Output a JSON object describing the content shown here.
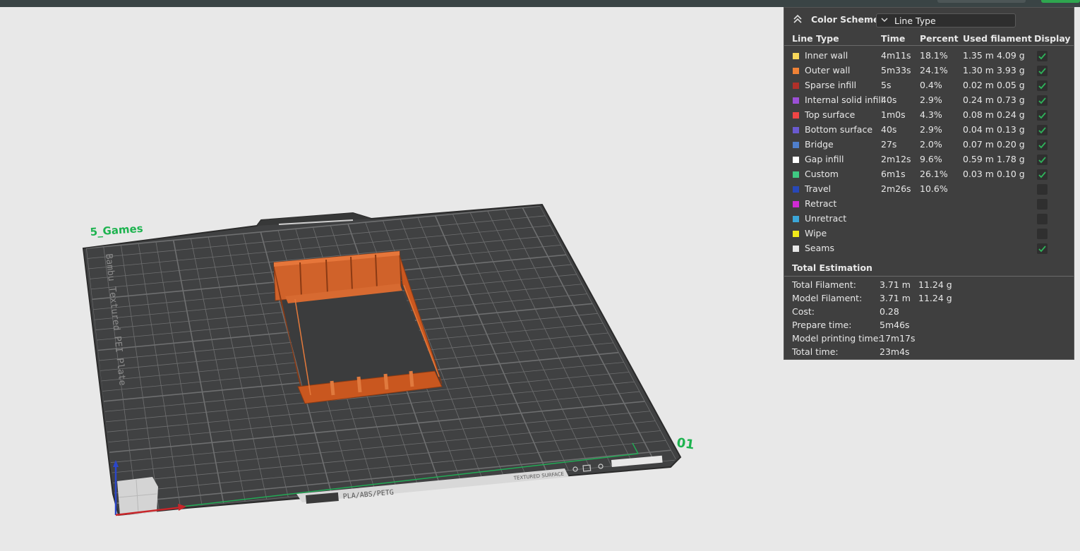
{
  "plate": {
    "name": "5_Games",
    "number": "01",
    "bed_label": "Bambu Textured PEI Plate",
    "material_label": "PLA/ABS/PETG",
    "surface_label": "TEXTURED SURFACE"
  },
  "panel": {
    "scheme_title": "Color Scheme",
    "scheme_value": "Line Type",
    "headers": {
      "line_type": "Line Type",
      "time": "Time",
      "percent": "Percent",
      "used": "Used filament",
      "display": "Display"
    },
    "rows": [
      {
        "name": "Inner wall",
        "color": "#f7d75a",
        "time": "4m11s",
        "percent": "18.1%",
        "meters": "1.35 m",
        "grams": "4.09 g",
        "checked": true
      },
      {
        "name": "Outer wall",
        "color": "#f08236",
        "time": "5m33s",
        "percent": "24.1%",
        "meters": "1.30 m",
        "grams": "3.93 g",
        "checked": true
      },
      {
        "name": "Sparse infill",
        "color": "#b03029",
        "time": "5s",
        "percent": "0.4%",
        "meters": "0.02 m",
        "grams": "0.05 g",
        "checked": true
      },
      {
        "name": "Internal solid infill",
        "color": "#9b4fd6",
        "time": "40s",
        "percent": "2.9%",
        "meters": "0.24 m",
        "grams": "0.73 g",
        "checked": true
      },
      {
        "name": "Top surface",
        "color": "#f04545",
        "time": "1m0s",
        "percent": "4.3%",
        "meters": "0.08 m",
        "grams": "0.24 g",
        "checked": true
      },
      {
        "name": "Bottom surface",
        "color": "#6a5ad0",
        "time": "40s",
        "percent": "2.9%",
        "meters": "0.04 m",
        "grams": "0.13 g",
        "checked": true
      },
      {
        "name": "Bridge",
        "color": "#4f7fcc",
        "time": "27s",
        "percent": "2.0%",
        "meters": "0.07 m",
        "grams": "0.20 g",
        "checked": true
      },
      {
        "name": "Gap infill",
        "color": "#ffffff",
        "time": "2m12s",
        "percent": "9.6%",
        "meters": "0.59 m",
        "grams": "1.78 g",
        "checked": true
      },
      {
        "name": "Custom",
        "color": "#3fc983",
        "time": "6m1s",
        "percent": "26.1%",
        "meters": "0.03 m",
        "grams": "0.10 g",
        "checked": true
      },
      {
        "name": "Travel",
        "color": "#2848b8",
        "time": "2m26s",
        "percent": "10.6%",
        "meters": "",
        "grams": "",
        "checked": false
      },
      {
        "name": "Retract",
        "color": "#d02ad4",
        "time": "",
        "percent": "",
        "meters": "",
        "grams": "",
        "checked": false
      },
      {
        "name": "Unretract",
        "color": "#3ba6d8",
        "time": "",
        "percent": "",
        "meters": "",
        "grams": "",
        "checked": false
      },
      {
        "name": "Wipe",
        "color": "#f2ea1a",
        "time": "",
        "percent": "",
        "meters": "",
        "grams": "",
        "checked": false
      },
      {
        "name": "Seams",
        "color": "#e8e8e8",
        "time": "",
        "percent": "",
        "meters": "",
        "grams": "",
        "checked": true
      }
    ],
    "total_title": "Total Estimation",
    "totals": [
      {
        "label": "Total Filament:",
        "v1": "3.71 m",
        "v2": "11.24 g"
      },
      {
        "label": "Model Filament:",
        "v1": "3.71 m",
        "v2": "11.24 g"
      },
      {
        "label": "Cost:",
        "v1": "0.28",
        "v2": ""
      },
      {
        "label": "Prepare time:",
        "v1": "5m46s",
        "v2": ""
      },
      {
        "label": "Model printing time:",
        "v1": "17m17s",
        "v2": ""
      },
      {
        "label": "Total time:",
        "v1": "23m4s",
        "v2": ""
      }
    ]
  }
}
